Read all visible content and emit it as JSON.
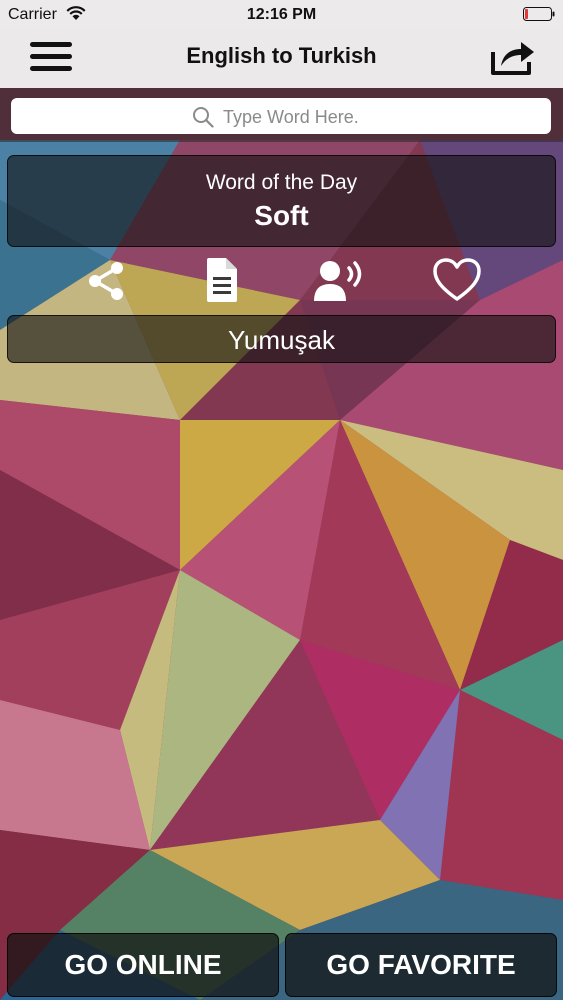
{
  "status_bar": {
    "carrier": "Carrier",
    "time": "12:16 PM"
  },
  "nav": {
    "title": "English to Turkish",
    "menu_icon": "hamburger-icon",
    "share_icon": "export-share-icon"
  },
  "search": {
    "placeholder": "Type Word Here.",
    "value": ""
  },
  "word_of_day": {
    "label": "Word of the Day",
    "word": "Soft"
  },
  "actions": [
    {
      "name": "share-icon"
    },
    {
      "name": "document-icon"
    },
    {
      "name": "speaker-icon"
    },
    {
      "name": "heart-icon"
    }
  ],
  "translation": {
    "text": "Yumuşak"
  },
  "buttons": {
    "online": "GO ONLINE",
    "favorite": "GO FAVORITE"
  },
  "colors": {
    "panel_bg": "#141414",
    "text": "#ffffff",
    "bar_bg": "#ebe9e9",
    "battery_red": "#e53935"
  }
}
